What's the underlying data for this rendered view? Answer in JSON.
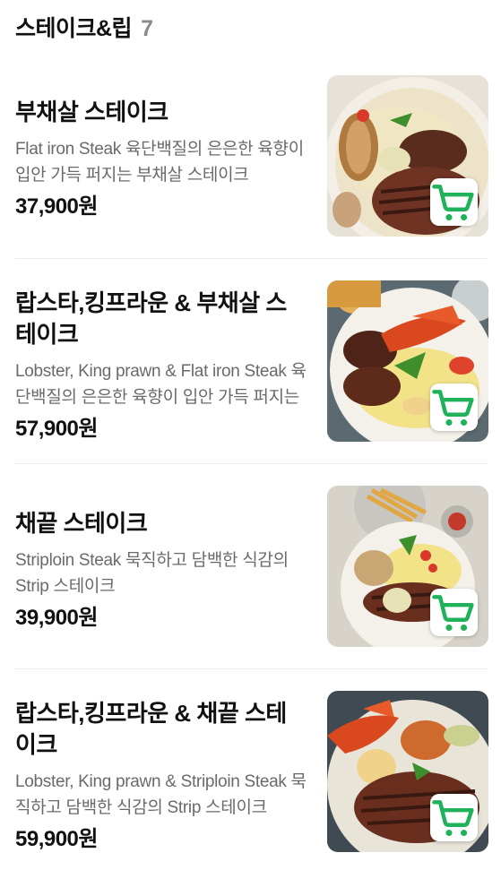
{
  "section": {
    "title": "스테이크&립",
    "count": "7"
  },
  "accent_color": "#1fb25a",
  "items": [
    {
      "name": "부채살 스테이크",
      "description": "Flat iron Steak 육단백질의 은은한 육향이 입안 가득 퍼지는 부채살 스테이크",
      "price": "37,900원"
    },
    {
      "name": "랍스타,킹프라운 & 부채살 스테이크",
      "description": "Lobster, King prawn & Flat iron Steak 육단백질의 은은한 육향이 입안 가득 퍼지는",
      "price": "57,900원"
    },
    {
      "name": "채끝 스테이크",
      "description": "Striploin Steak 묵직하고 담백한 식감의 Strip 스테이크",
      "price": "39,900원"
    },
    {
      "name": "랍스타,킹프라운 & 채끝 스테이크",
      "description": "Lobster, King prawn & Striploin Steak 묵직하고 담백한 식감의 Strip 스테이크",
      "price": "59,900원"
    }
  ]
}
